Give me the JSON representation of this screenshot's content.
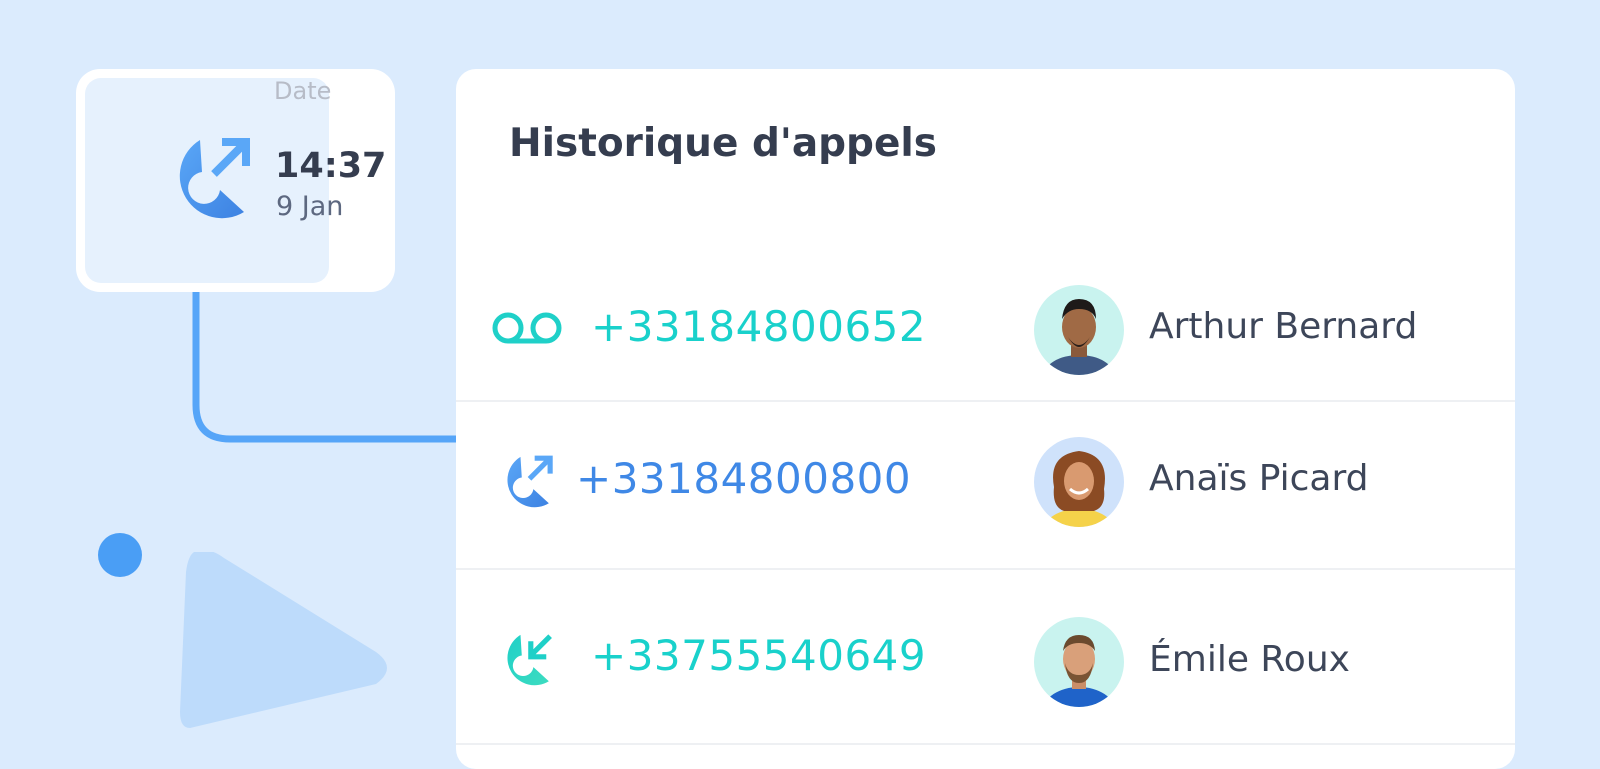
{
  "date_card": {
    "label": "Date",
    "time": "14:37",
    "day": "9 Jan",
    "icon": "outgoing-call-icon"
  },
  "history": {
    "title": "Historique d'appels",
    "calls": [
      {
        "type": "voicemail",
        "icon": "voicemail-icon",
        "number": "+33184800652",
        "number_color": "#19d1cb",
        "contact": "Arthur Bernard",
        "avatar_bg": "#c9f3ef"
      },
      {
        "type": "outgoing",
        "icon": "outgoing-call-icon",
        "number": "+33184800800",
        "number_color": "#3f88e6",
        "contact": "Anaïs Picard",
        "avatar_bg": "#cfe2fb"
      },
      {
        "type": "incoming",
        "icon": "incoming-call-icon",
        "number": "+33755540649",
        "number_color": "#19d1cb",
        "contact": "Émile Roux",
        "avatar_bg": "#c9f3ef"
      }
    ]
  },
  "colors": {
    "background": "#dbebfd",
    "accent_blue": "#4a9ef5",
    "accent_teal": "#19d1cb",
    "text_dark": "#353d4f"
  }
}
